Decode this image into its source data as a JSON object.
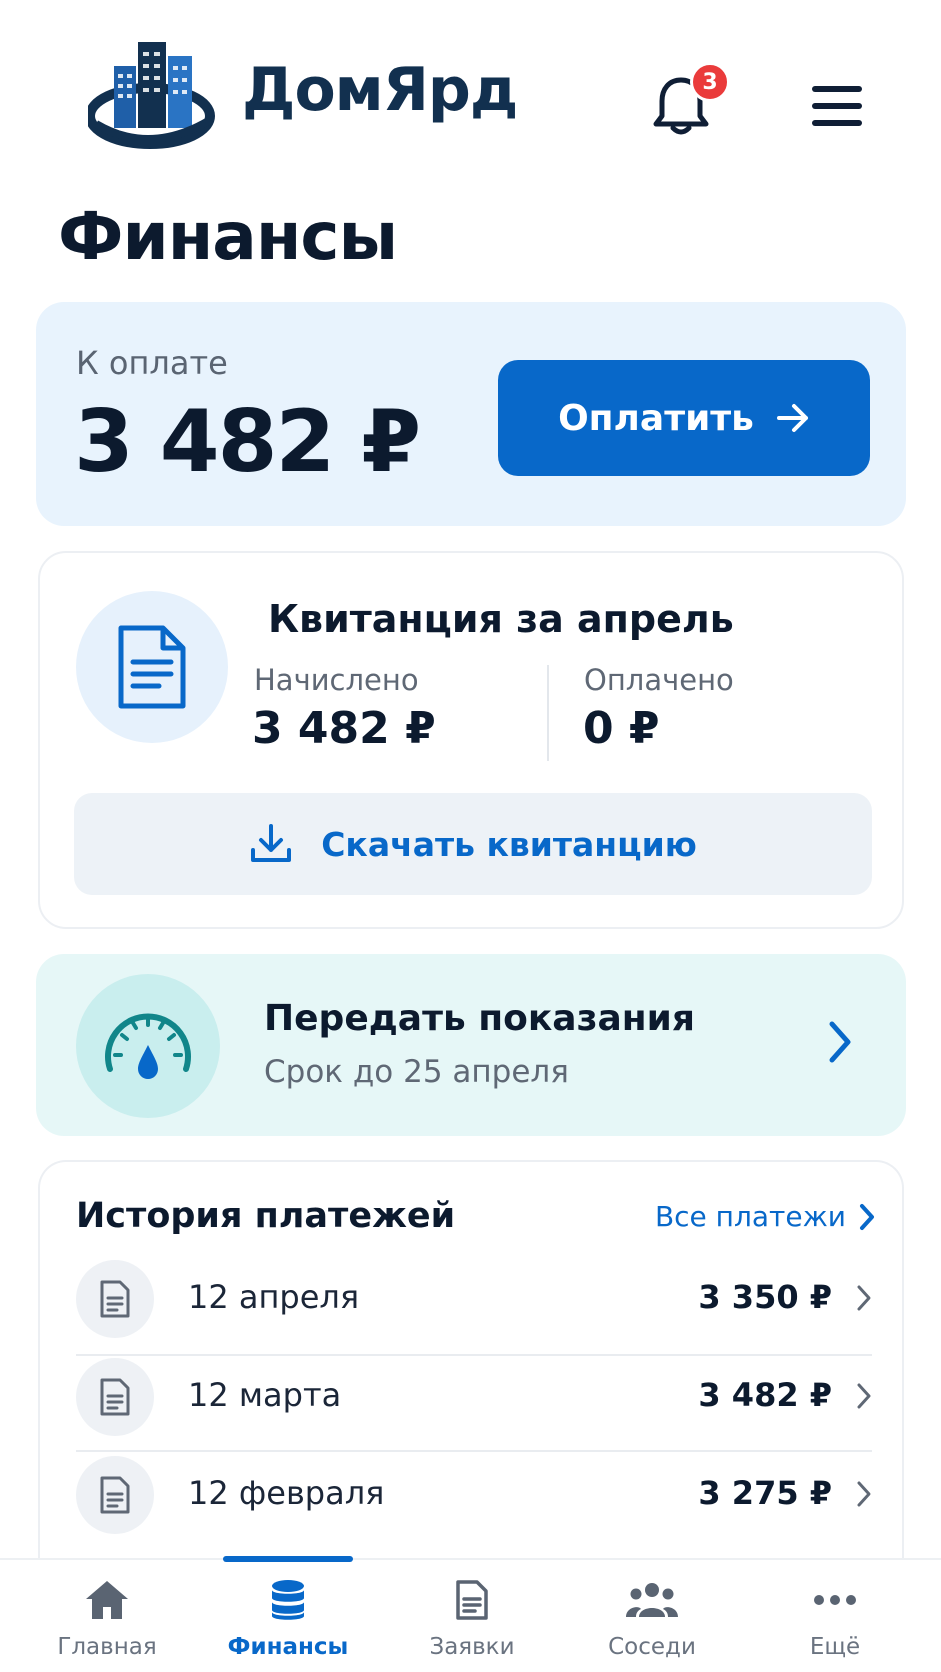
{
  "app": {
    "name": "ДомЯрд"
  },
  "header": {
    "notifications_count": "3"
  },
  "page": {
    "title": "Финансы"
  },
  "payment": {
    "label": "К оплате",
    "amount": "3 482 ₽",
    "button_label": "Оплатить"
  },
  "receipt": {
    "title": "Квитанция за апрель",
    "accrued_label": "Начислено",
    "accrued_value": "3 482 ₽",
    "paid_label": "Оплачено",
    "paid_value": "0 ₽",
    "download_label": "Скачать квитанцию"
  },
  "meters": {
    "title": "Передать показания",
    "subtitle": "Срок до 25 апреля"
  },
  "history": {
    "title": "История платежей",
    "all_label": "Все платежи",
    "items": [
      {
        "date": "12 апреля",
        "amount": "3 350 ₽"
      },
      {
        "date": "12 марта",
        "amount": "3 482 ₽"
      },
      {
        "date": "12 февраля",
        "amount": "3 275 ₽"
      }
    ]
  },
  "nav": {
    "items": [
      {
        "label": "Главная",
        "icon": "home-icon"
      },
      {
        "label": "Финансы",
        "icon": "database-coins-icon",
        "active": true
      },
      {
        "label": "Заявки",
        "icon": "document-icon"
      },
      {
        "label": "Соседи",
        "icon": "people-icon"
      },
      {
        "label": "Ещё",
        "icon": "more-dots-icon"
      }
    ]
  },
  "colors": {
    "accent": "#0868c9",
    "badge": "#ea3b3b",
    "meter_teal": "#11868a"
  }
}
